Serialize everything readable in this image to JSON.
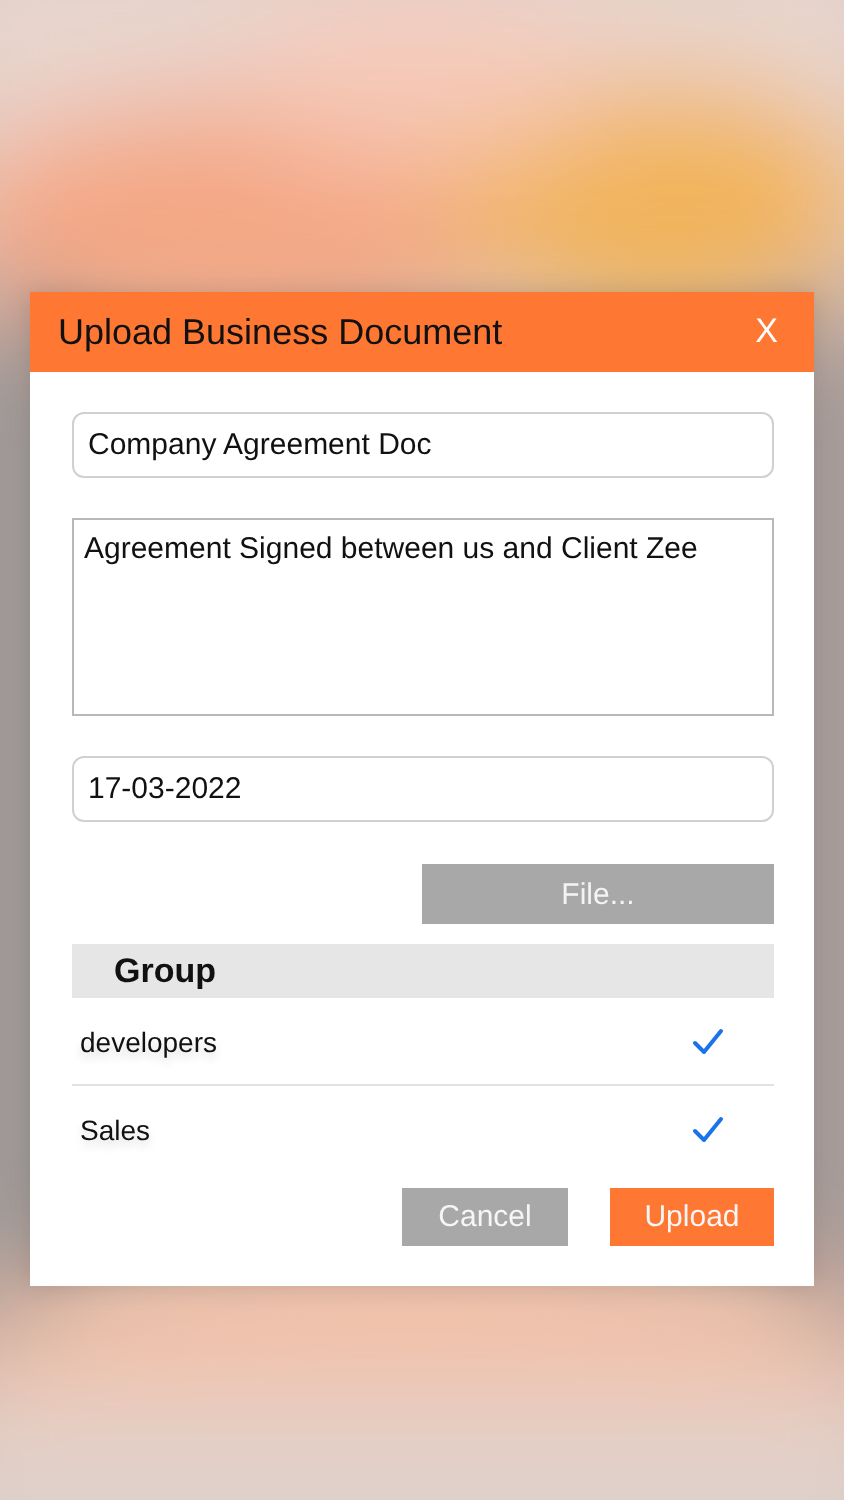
{
  "dialog": {
    "title": "Upload Business Document",
    "close": "X"
  },
  "fields": {
    "name": {
      "value": "Company Agreement Doc"
    },
    "description": {
      "value": "Agreement Signed between us and Client Zee"
    },
    "date": {
      "value": "17-03-2022"
    }
  },
  "file_button": "File...",
  "group": {
    "heading": "Group",
    "items": [
      {
        "label": "developers",
        "checked": true
      },
      {
        "label": "Sales",
        "checked": true
      }
    ]
  },
  "buttons": [
    {
      "label": "Cancel",
      "kind": "secondary"
    },
    {
      "label": "Upload",
      "kind": "primary"
    }
  ]
}
